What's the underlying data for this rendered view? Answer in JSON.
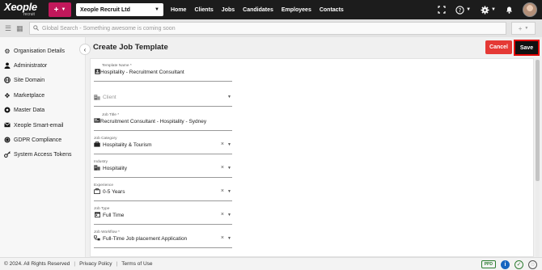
{
  "topbar": {
    "logo_text": "Xeople",
    "logo_sub": "recruit",
    "plus_label": "+",
    "company": "Xeople Recruit Ltd",
    "nav": [
      "Home",
      "Clients",
      "Jobs",
      "Candidates",
      "Employees",
      "Contacts"
    ]
  },
  "search": {
    "placeholder": "Global Search - Something awesome is coming soon",
    "add_label": "+"
  },
  "sidebar": {
    "items": [
      {
        "label": "Organisation Details",
        "icon": "gear-icon"
      },
      {
        "label": "Administrator",
        "icon": "user-icon"
      },
      {
        "label": "Site Domain",
        "icon": "globe-icon"
      },
      {
        "label": "Marketplace",
        "icon": "move-icon"
      },
      {
        "label": "Master Data",
        "icon": "settings-icon"
      },
      {
        "label": "Xeople Smart-email",
        "icon": "envelope-icon"
      },
      {
        "label": "GDPR Compliance",
        "icon": "gdpr-icon"
      },
      {
        "label": "System Access Tokens",
        "icon": "key-icon"
      }
    ]
  },
  "main": {
    "title": "Create Job Template",
    "cancel_label": "Cancel",
    "save_label": "Save"
  },
  "form": {
    "template_name": {
      "label": "Template Name *",
      "value": "Hospitality - Recruitment Consultant"
    },
    "client": {
      "label": "",
      "placeholder": "Client"
    },
    "job_title": {
      "label": "Job Title *",
      "value": "Recruitment Consultant - Hospitality - Sydney"
    },
    "job_category": {
      "label": "Job Category",
      "value": "Hospitality & Tourism"
    },
    "industry": {
      "label": "Industry",
      "value": "Hospitality"
    },
    "experience": {
      "label": "Experience",
      "value": "0-5 Years"
    },
    "job_type": {
      "label": "Job Type",
      "value": "Full Time"
    },
    "job_workflow": {
      "label": "Job Workflow *",
      "value": "Full-Time Job placement Application"
    }
  },
  "footer": {
    "copyright": "© 2024. All Rights Reserved",
    "privacy": "Privacy Policy",
    "terms": "Terms of Use",
    "ppd": "PPD"
  }
}
